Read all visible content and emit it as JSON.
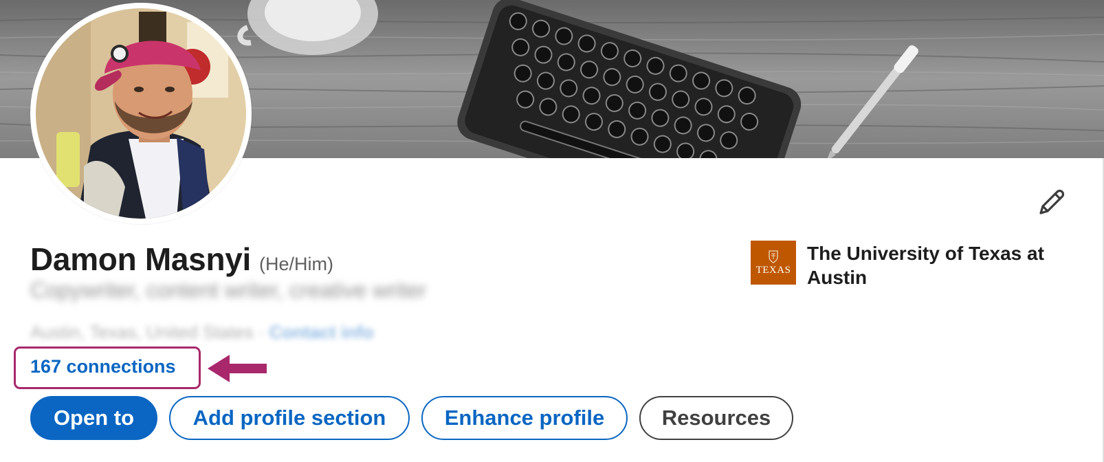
{
  "profile": {
    "name": "Damon Masnyi",
    "pronouns": "(He/Him)",
    "headline": "Copywriter, content writer, creative writer",
    "location": "Austin, Texas, United States ·",
    "contact_info": "Contact info",
    "connections": "167 connections"
  },
  "education": {
    "school": "The University of Texas at Austin",
    "logo_text": "TEXAS",
    "logo_color": "#bf5700"
  },
  "actions": {
    "open_to": "Open to",
    "add_section": "Add profile section",
    "enhance": "Enhance profile",
    "resources": "Resources"
  },
  "icons": {
    "edit": "pencil-icon",
    "annotation": "arrow-left-icon"
  },
  "colors": {
    "accent": "#0a66c2",
    "highlight": "#a8286b",
    "text": "#1d1d1d"
  }
}
